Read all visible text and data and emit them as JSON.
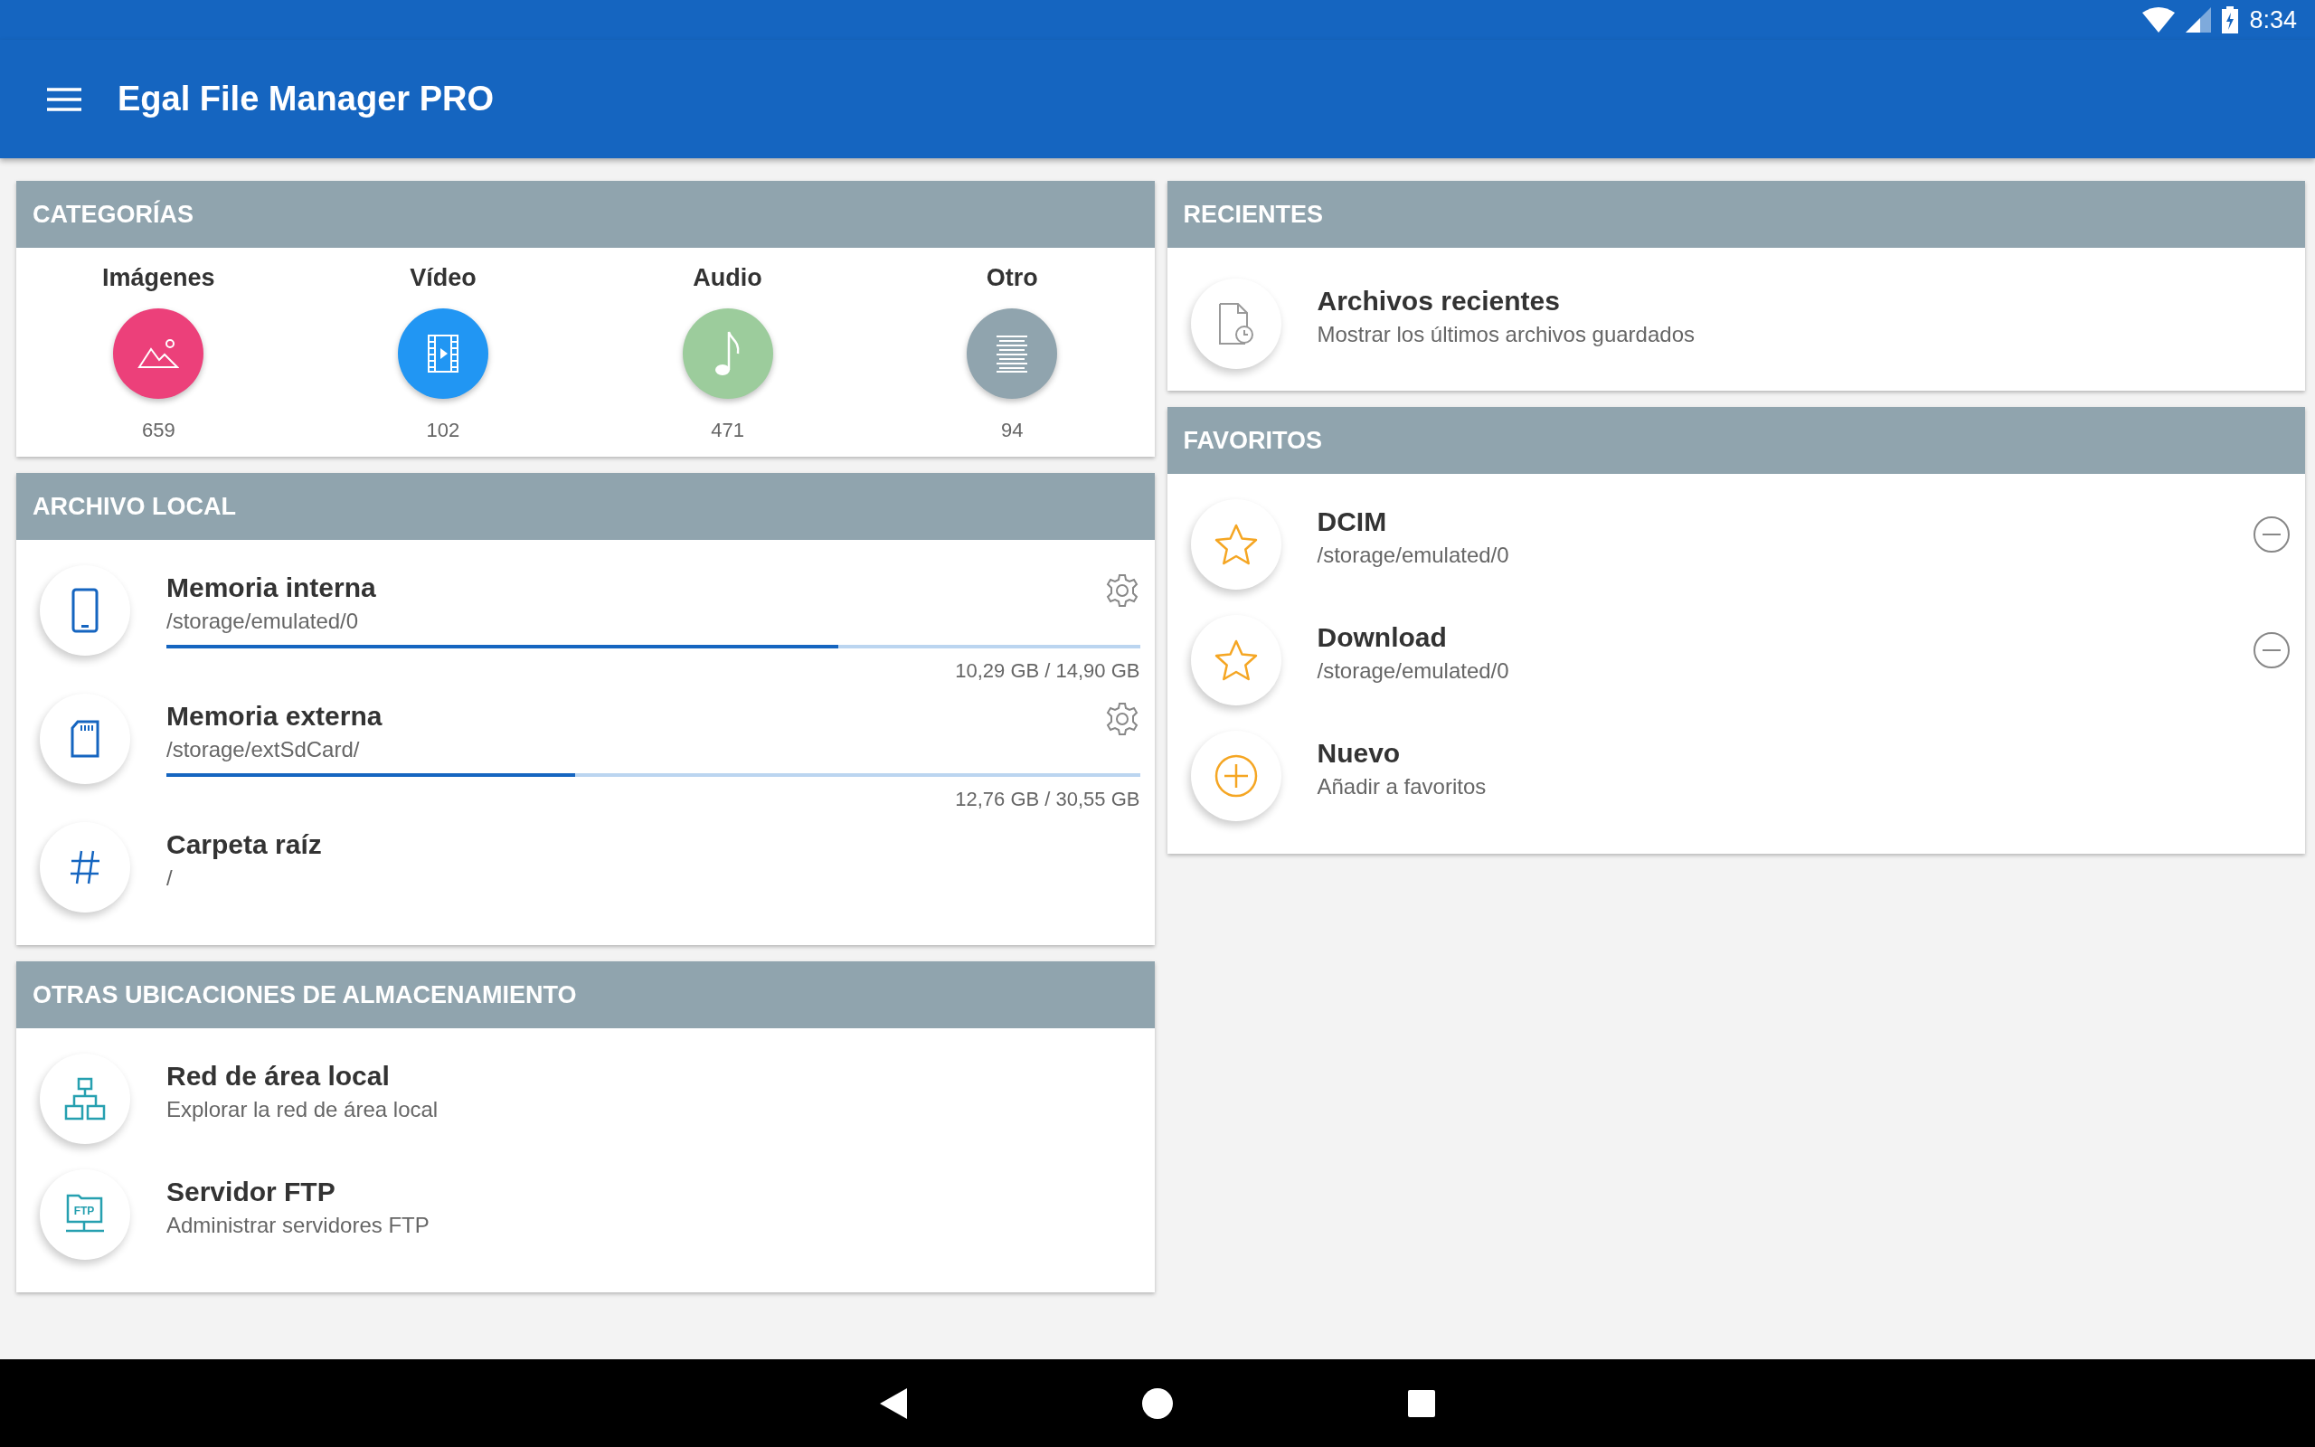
{
  "status_bar": {
    "time": "8:34"
  },
  "app_bar": {
    "title": "Egal File Manager PRO"
  },
  "categories": {
    "title": "CATEGORÍAS",
    "items": [
      {
        "label": "Imágenes",
        "count": "659",
        "color": "#ec407a"
      },
      {
        "label": "Vídeo",
        "count": "102",
        "color": "#2196f3"
      },
      {
        "label": "Audio",
        "count": "471",
        "color": "#9ccc9c"
      },
      {
        "label": "Otro",
        "count": "94",
        "color": "#90a4ae"
      }
    ]
  },
  "local_storage": {
    "title": "ARCHIVO LOCAL",
    "items": [
      {
        "kind": "phone",
        "title": "Memoria interna",
        "path": "/storage/emulated/0",
        "level": 0.69,
        "usage": "10,29 GB / 14,90 GB"
      },
      {
        "kind": "sdcard",
        "title": "Memoria externa",
        "path": "/storage/extSdCard/",
        "level": 0.42,
        "usage": "12,76 GB / 30,55 GB"
      },
      {
        "kind": "root",
        "title": "Carpeta raíz",
        "path": "/"
      }
    ]
  },
  "other_locations": {
    "title": "OTRAS UBICACIONES DE ALMACENAMIENTO",
    "items": [
      {
        "kind": "network",
        "title": "Red de área local",
        "subtitle": "Explorar la red de área local"
      },
      {
        "kind": "ftp",
        "title": "Servidor FTP",
        "subtitle": "Administrar servidores FTP",
        "icon_text": "FTP"
      }
    ]
  },
  "recent": {
    "title": "RECIENTES",
    "items": [
      {
        "title": "Archivos recientes",
        "subtitle": "Mostrar los últimos archivos guardados"
      }
    ]
  },
  "favorites": {
    "title": "FAVORITOS",
    "items": [
      {
        "kind": "favorite",
        "title": "DCIM",
        "subtitle": "/storage/emulated/0",
        "removable": true
      },
      {
        "kind": "favorite",
        "title": "Download",
        "subtitle": "/storage/emulated/0",
        "removable": true
      },
      {
        "kind": "add",
        "title": "Nuevo",
        "subtitle": "Añadir a favoritos",
        "removable": false
      }
    ]
  }
}
